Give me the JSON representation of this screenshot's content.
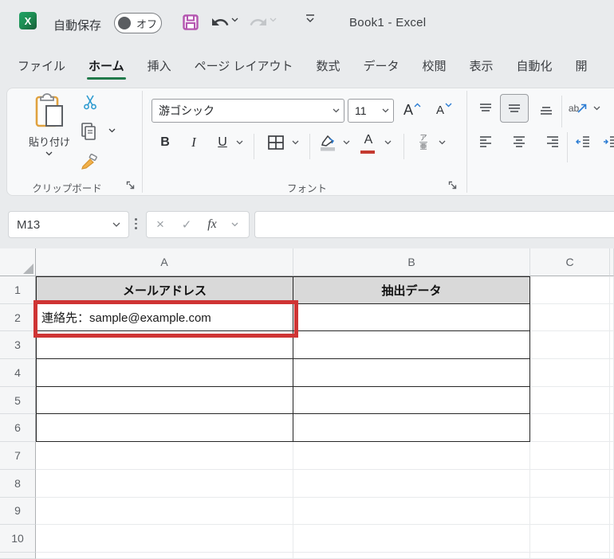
{
  "titlebar": {
    "autosave_label": "自動保存",
    "autosave_state": "オフ",
    "title": "Book1 - Excel"
  },
  "tabs": [
    {
      "label": "ファイル"
    },
    {
      "label": "ホーム"
    },
    {
      "label": "挿入"
    },
    {
      "label": "ページ レイアウト"
    },
    {
      "label": "数式"
    },
    {
      "label": "データ"
    },
    {
      "label": "校閲"
    },
    {
      "label": "表示"
    },
    {
      "label": "自動化"
    },
    {
      "label": "開"
    }
  ],
  "ribbon": {
    "clipboard": {
      "paste_label": "貼り付け",
      "group_label": "クリップボード"
    },
    "font": {
      "name": "游ゴシック",
      "size": "11",
      "bold": "B",
      "italic": "I",
      "underline": "U",
      "increase_letter": "A",
      "decrease_letter": "A",
      "color_letter": "A",
      "phonetic_top": "ア",
      "phonetic_bottom": "亜",
      "group_label": "フォント"
    },
    "alignment": {
      "orientation_label": "ab"
    }
  },
  "formula_bar": {
    "cell_ref": "M13",
    "cancel_glyph": "×",
    "enter_glyph": "✓",
    "fx_label": "fx",
    "formula": ""
  },
  "grid": {
    "col_headers": [
      "A",
      "B",
      "C"
    ],
    "row_headers": [
      "1",
      "2",
      "3",
      "4",
      "5",
      "6",
      "7",
      "8",
      "9",
      "10"
    ],
    "cells": {
      "A1": "メールアドレス",
      "B1": "抽出データ",
      "A2": "連絡先：sample@example.com"
    }
  },
  "colors": {
    "accent_green": "#217a4b",
    "annotation_red": "#cf3434",
    "header_fill": "#d9d9d9",
    "save_icon_magenta": "#b455b0"
  }
}
